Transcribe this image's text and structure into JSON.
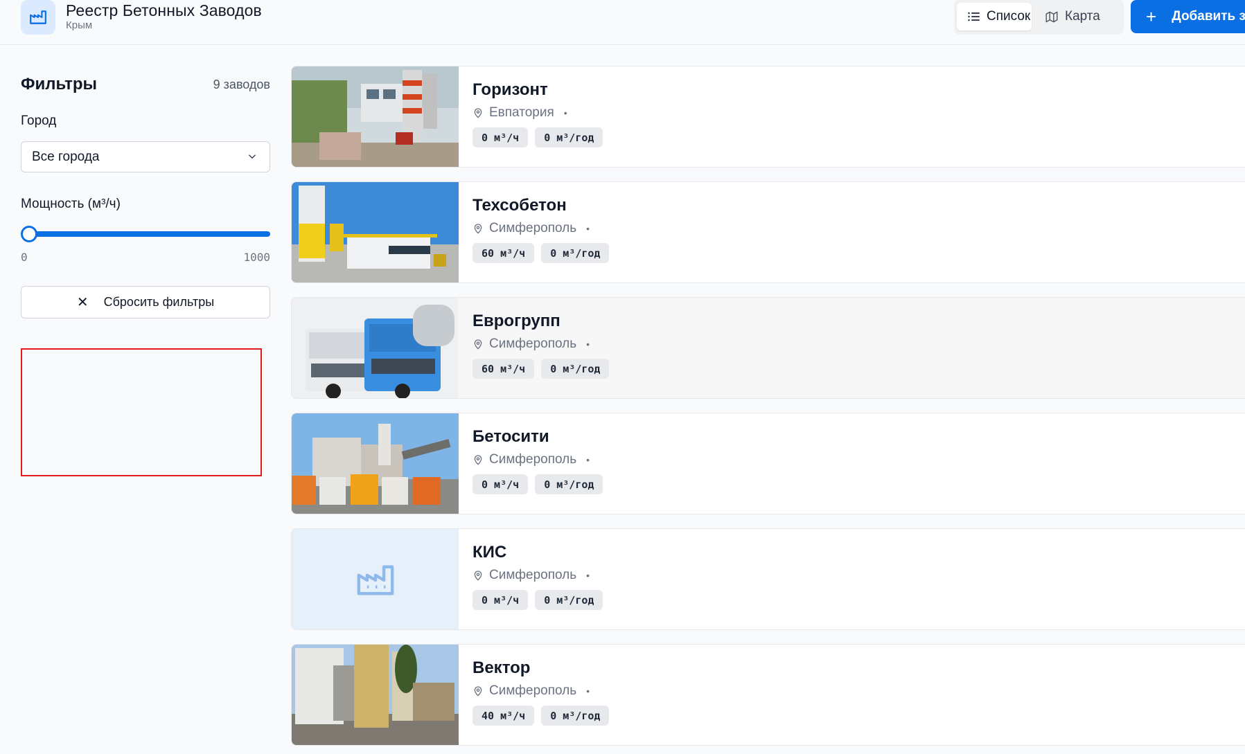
{
  "header": {
    "title": "Реестр Бетонных Заводов",
    "subtitle": "Крым",
    "view_list_label": "Список",
    "view_map_label": "Карта",
    "add_label": "Добавить за",
    "logo_icon": "factory-icon",
    "accent_color": "#0b6fe4"
  },
  "sidebar": {
    "title": "Фильтры",
    "count": "9 заводов",
    "city_label": "Город",
    "city_value": "Все города",
    "power_label": "Мощность (м³/ч)",
    "power_min": "0",
    "power_max": "1000",
    "power_value_fraction": 0,
    "reset_label": "Сбросить фильтры"
  },
  "plants": [
    {
      "name": "Горизонт",
      "city": "Евпатория",
      "dot": "•",
      "per_hour": "0 м³/ч",
      "per_year": "0 м³/год",
      "image": "photo-plant"
    },
    {
      "name": "Техсобетон",
      "city": "Симферополь",
      "dot": "•",
      "per_hour": "60 м³/ч",
      "per_year": "0 м³/год",
      "image": "photo-silos"
    },
    {
      "name": "Еврогрупп",
      "city": "Симферополь",
      "dot": "•",
      "per_hour": "60 м³/ч",
      "per_year": "0 м³/год",
      "image": "photo-trucks"
    },
    {
      "name": "Бетосити",
      "city": "Симферополь",
      "dot": "•",
      "per_hour": "0 м³/ч",
      "per_year": "0 м³/год",
      "image": "photo-fleet"
    },
    {
      "name": "КИС",
      "city": "Симферополь",
      "dot": "•",
      "per_hour": "0 м³/ч",
      "per_year": "0 м³/год",
      "image": "placeholder-factory-icon"
    },
    {
      "name": "Вектор",
      "city": "Симферополь",
      "dot": "•",
      "per_hour": "40 м³/ч",
      "per_year": "0 м³/год",
      "image": "photo-tower"
    }
  ]
}
